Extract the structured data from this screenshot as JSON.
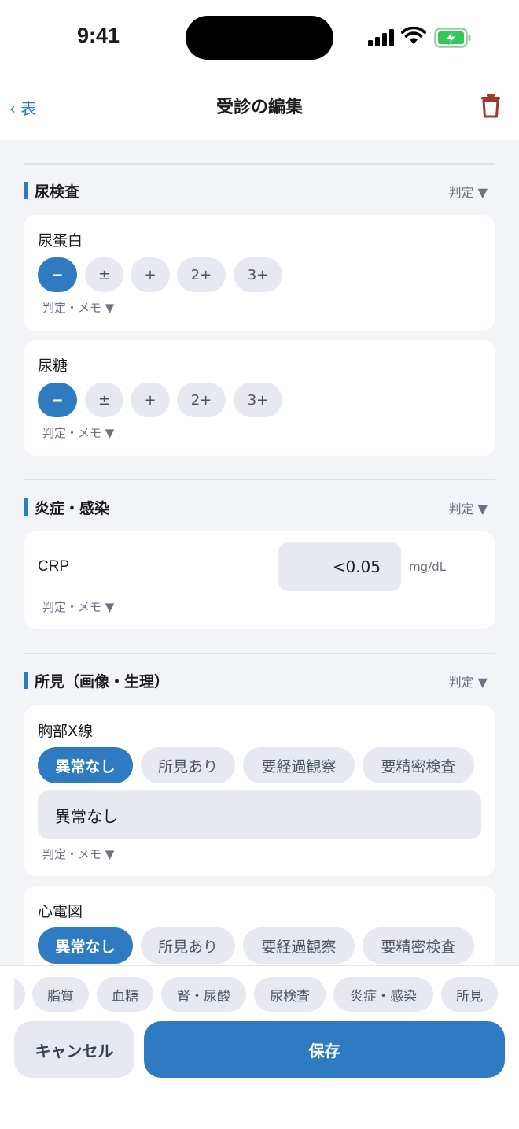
{
  "status": {
    "time": "9:41"
  },
  "nav": {
    "back": "‹ 表",
    "title": "受診の編集"
  },
  "sections": {
    "urine": {
      "title": "尿検査",
      "judge": "判定 ▼"
    },
    "inflammation": {
      "title": "炎症・感染",
      "judge": "判定 ▼"
    },
    "findings": {
      "title": "所見（画像・生理）",
      "judge": "判定 ▼"
    }
  },
  "urine_protein": {
    "label": "尿蛋白",
    "options": [
      "−",
      "±",
      "+",
      "2+",
      "3+"
    ],
    "selected": "−",
    "memo": "判定・メモ ▼"
  },
  "urine_sugar": {
    "label": "尿糖",
    "options": [
      "−",
      "±",
      "+",
      "2+",
      "3+"
    ],
    "selected": "−",
    "memo": "判定・メモ ▼"
  },
  "crp": {
    "label": "CRP",
    "value": "<0.05",
    "unit": "mg/dL",
    "memo": "判定・メモ ▼"
  },
  "chest_xray": {
    "label": "胸部X線",
    "options": [
      "異常なし",
      "所見あり",
      "要経過観察",
      "要精密検査"
    ],
    "selected": "異常なし",
    "note": "異常なし",
    "memo": "判定・メモ ▼"
  },
  "ecg": {
    "label": "心電図",
    "options": [
      "異常なし",
      "所見あり",
      "要経過観察",
      "要精密検査"
    ],
    "selected": "異常なし"
  },
  "chips": [
    "脂質",
    "血糖",
    "腎・尿酸",
    "尿検査",
    "炎症・感染",
    "所見"
  ],
  "buttons": {
    "cancel": "キャンセル",
    "save": "保存"
  },
  "colors": {
    "accent": "#2f7bc1",
    "delete": "#a3372e",
    "battery": "#34c759"
  }
}
